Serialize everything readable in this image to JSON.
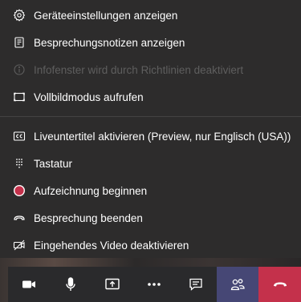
{
  "menu": {
    "items": [
      {
        "label": "Geräteeinstellungen anzeigen",
        "icon": "gear-icon",
        "enabled": true
      },
      {
        "label": "Besprechungsnotizen anzeigen",
        "icon": "notes-icon",
        "enabled": true
      },
      {
        "label": "Infofenster wird durch Richtlinien deaktiviert",
        "icon": "info-icon",
        "enabled": false
      },
      {
        "label": "Vollbildmodus aufrufen",
        "icon": "fullscreen-icon",
        "enabled": true
      },
      {
        "label": "Liveuntertitel aktivieren (Preview, nur Englisch (USA))",
        "icon": "captions-icon",
        "enabled": true
      },
      {
        "label": "Tastatur",
        "icon": "keypad-icon",
        "enabled": true
      },
      {
        "label": "Aufzeichnung beginnen",
        "icon": "record-icon",
        "enabled": true
      },
      {
        "label": "Besprechung beenden",
        "icon": "end-meeting-icon",
        "enabled": true
      },
      {
        "label": "Eingehendes Video deaktivieren",
        "icon": "video-off-icon",
        "enabled": true
      }
    ]
  },
  "toolbar": {
    "buttons": [
      "camera-icon",
      "microphone-icon",
      "share-screen-icon",
      "more-options-icon",
      "chat-icon",
      "participants-icon",
      "hang-up-icon"
    ]
  },
  "colors": {
    "menu_background": "#2d2c2c",
    "record_red": "#c4314b",
    "participants_active": "#464775",
    "hang_up": "#c4314b"
  }
}
